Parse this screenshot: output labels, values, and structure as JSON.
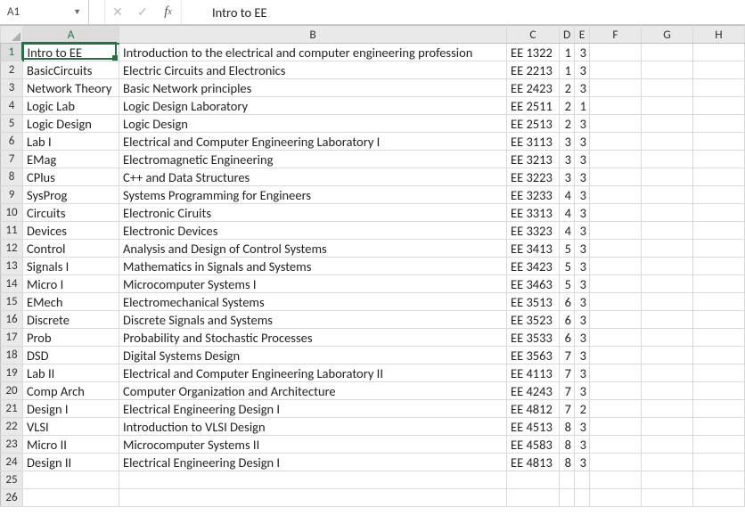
{
  "formula_bar": {
    "namebox": "A1",
    "value": "Intro to EE"
  },
  "columns": [
    "A",
    "B",
    "C",
    "D",
    "E",
    "F",
    "G",
    "H"
  ],
  "row_count": 26,
  "active_cell": {
    "row": 1,
    "col": "A"
  },
  "chart_data": {
    "type": "table",
    "columns": [
      "A",
      "B",
      "C",
      "D",
      "E"
    ],
    "rows": [
      {
        "A": "Intro to EE",
        "B": "Introduction to the electrical and computer engineering profession",
        "C": "EE 1322",
        "D": 1,
        "E": 3
      },
      {
        "A": "BasicCircuits",
        "B": "Electric Circuits and Electronics",
        "C": "EE 2213",
        "D": 1,
        "E": 3
      },
      {
        "A": "Network Theory",
        "B": "Basic Network principles",
        "C": "EE 2423",
        "D": 2,
        "E": 3
      },
      {
        "A": "Logic Lab",
        "B": "Logic Design Laboratory",
        "C": "EE 2511",
        "D": 2,
        "E": 1
      },
      {
        "A": "Logic Design",
        "B": "Logic Design",
        "C": "EE 2513",
        "D": 2,
        "E": 3
      },
      {
        "A": "Lab I",
        "B": "Electrical and Computer Engineering Laboratory I",
        "C": "EE 3113",
        "D": 3,
        "E": 3
      },
      {
        "A": "EMag",
        "B": "Electromagnetic Engineering",
        "C": "EE 3213",
        "D": 3,
        "E": 3
      },
      {
        "A": "CPlus",
        "B": "C++ and Data Structures",
        "C": "EE 3223",
        "D": 3,
        "E": 3
      },
      {
        "A": "SysProg",
        "B": "Systems Programming for Engineers",
        "C": "EE 3233",
        "D": 4,
        "E": 3
      },
      {
        "A": "Circuits",
        "B": "Electronic Ciruits",
        "C": "EE 3313",
        "D": 4,
        "E": 3
      },
      {
        "A": "Devices",
        "B": "Electronic Devices",
        "C": "EE 3323",
        "D": 4,
        "E": 3
      },
      {
        "A": "Control",
        "B": "Analysis and Design of Control Systems",
        "C": "EE 3413",
        "D": 5,
        "E": 3
      },
      {
        "A": "Signals I",
        "B": "Mathematics in Signals and Systems",
        "C": "EE 3423",
        "D": 5,
        "E": 3
      },
      {
        "A": "Micro I",
        "B": "Microcomputer Systems I",
        "C": "EE 3463",
        "D": 5,
        "E": 3
      },
      {
        "A": "EMech",
        "B": "Electromechanical Systems",
        "C": "EE 3513",
        "D": 6,
        "E": 3
      },
      {
        "A": "Discrete",
        "B": "Discrete Signals and Systems",
        "C": "EE 3523",
        "D": 6,
        "E": 3
      },
      {
        "A": "Prob",
        "B": "Probability and Stochastic Processes",
        "C": "EE 3533",
        "D": 6,
        "E": 3
      },
      {
        "A": "DSD",
        "B": "Digital Systems Design",
        "C": "EE 3563",
        "D": 7,
        "E": 3
      },
      {
        "A": "Lab II",
        "B": "Electrical and Computer Engineering Laboratory II",
        "C": "EE 4113",
        "D": 7,
        "E": 3
      },
      {
        "A": "Comp Arch",
        "B": "Computer Organization and Architecture",
        "C": "EE 4243",
        "D": 7,
        "E": 3
      },
      {
        "A": "Design I",
        "B": "Electrical Engineering Design I",
        "C": "EE 4812",
        "D": 7,
        "E": 2
      },
      {
        "A": "VLSI",
        "B": "Introduction to VLSI Design",
        "C": "EE 4513",
        "D": 8,
        "E": 3
      },
      {
        "A": "Micro II",
        "B": "Microcomputer Systems II",
        "C": "EE 4583",
        "D": 8,
        "E": 3
      },
      {
        "A": "Design II",
        "B": "Electrical Engineering Design I",
        "C": "EE 4813",
        "D": 8,
        "E": 3
      }
    ]
  }
}
